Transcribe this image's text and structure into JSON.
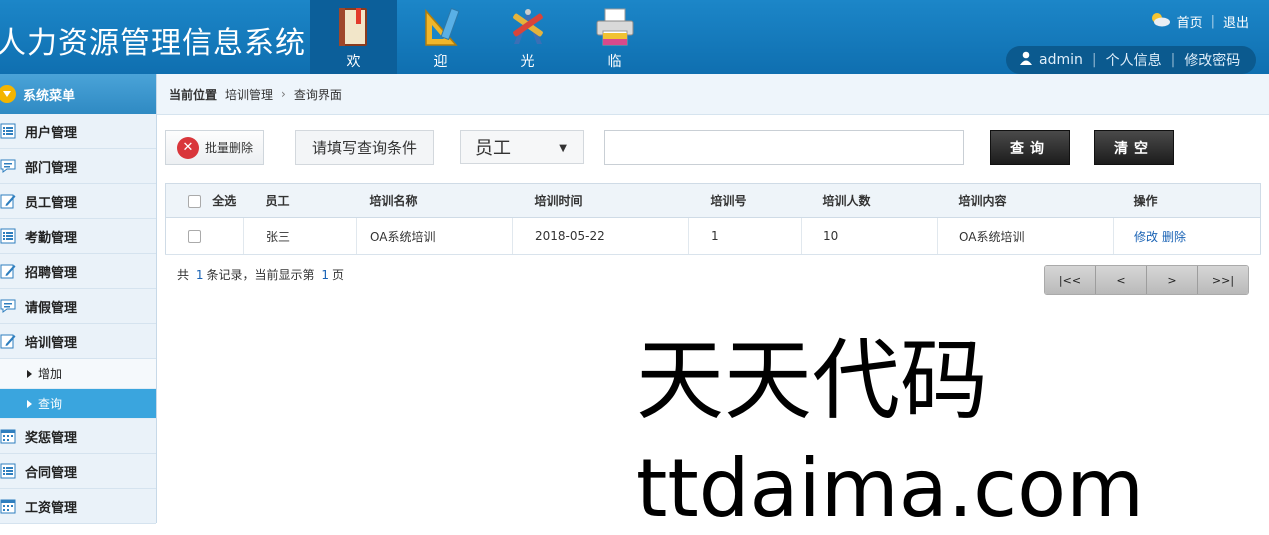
{
  "app": {
    "title": "人力资源管理信息系统"
  },
  "topnav": [
    {
      "label": "欢",
      "icon": "book-icon",
      "active": true
    },
    {
      "label": "迎",
      "icon": "ruler-triangle-icon",
      "active": false
    },
    {
      "label": "光",
      "icon": "pencil-tools-icon",
      "active": false
    },
    {
      "label": "临",
      "icon": "printer-icon",
      "active": false
    }
  ],
  "header": {
    "home": "首页",
    "logout": "退出",
    "user": "admin",
    "profile": "个人信息",
    "change_password": "修改密码"
  },
  "sidebar": {
    "title": "系统菜单",
    "items": [
      {
        "label": "用户管理",
        "icon": "list-icon"
      },
      {
        "label": "部门管理",
        "icon": "chat-icon"
      },
      {
        "label": "员工管理",
        "icon": "edit-icon"
      },
      {
        "label": "考勤管理",
        "icon": "list-icon"
      },
      {
        "label": "招聘管理",
        "icon": "edit-icon"
      },
      {
        "label": "请假管理",
        "icon": "chat-icon"
      },
      {
        "label": "培训管理",
        "icon": "edit-icon"
      }
    ],
    "subitems": [
      {
        "label": "增加"
      },
      {
        "label": "查询",
        "active": true
      }
    ],
    "items_after": [
      {
        "label": "奖惩管理",
        "icon": "calendar-icon"
      },
      {
        "label": "合同管理",
        "icon": "list-icon"
      },
      {
        "label": "工资管理",
        "icon": "calendar-icon"
      }
    ]
  },
  "breadcrumb": {
    "label": "当前位置",
    "parent": "培训管理",
    "current": "查询界面"
  },
  "toolbar": {
    "batch_delete": "批量删除",
    "condition_prompt": "请填写查询条件",
    "select_value": "员工",
    "query": "查询",
    "clear": "清空",
    "input_value": ""
  },
  "table": {
    "select_all": "全选",
    "columns": [
      "员工",
      "培训名称",
      "培训时间",
      "培训号",
      "培训人数",
      "培训内容",
      "操作"
    ],
    "rows": [
      {
        "employee": "张三",
        "name": "OA系统培训",
        "time": "2018-05-22",
        "no": "1",
        "count": "10",
        "content": "OA系统培训",
        "edit": "修改",
        "delete": "删除"
      }
    ]
  },
  "paging": {
    "prefix": "共",
    "total": "1",
    "middle": "条记录，当前显示第",
    "page": "1",
    "suffix": "页",
    "first": "|<<",
    "prev": "<",
    "next": ">",
    "last": ">>|"
  },
  "watermark": {
    "line1": "天天代码",
    "line2": "ttdaima.com"
  }
}
